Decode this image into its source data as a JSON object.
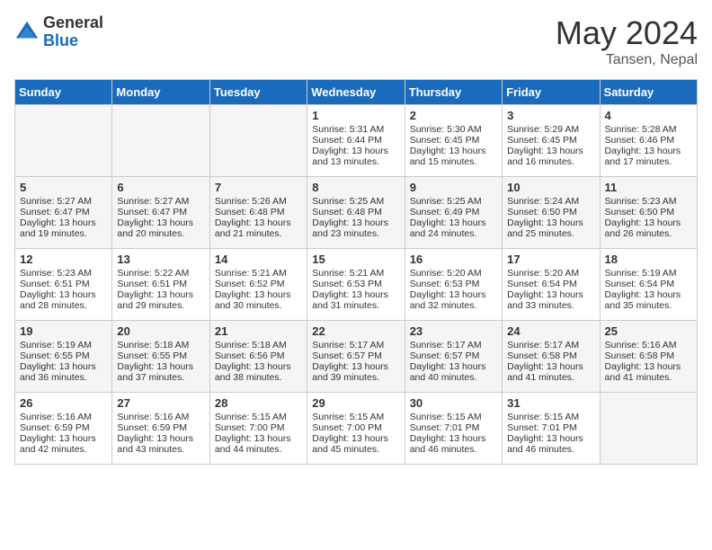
{
  "header": {
    "logo_general": "General",
    "logo_blue": "Blue",
    "month_year": "May 2024",
    "location": "Tansen, Nepal"
  },
  "days_of_week": [
    "Sunday",
    "Monday",
    "Tuesday",
    "Wednesday",
    "Thursday",
    "Friday",
    "Saturday"
  ],
  "weeks": [
    [
      {
        "day": "",
        "info": ""
      },
      {
        "day": "",
        "info": ""
      },
      {
        "day": "",
        "info": ""
      },
      {
        "day": "1",
        "info": "Sunrise: 5:31 AM\nSunset: 6:44 PM\nDaylight: 13 hours\nand 13 minutes."
      },
      {
        "day": "2",
        "info": "Sunrise: 5:30 AM\nSunset: 6:45 PM\nDaylight: 13 hours\nand 15 minutes."
      },
      {
        "day": "3",
        "info": "Sunrise: 5:29 AM\nSunset: 6:45 PM\nDaylight: 13 hours\nand 16 minutes."
      },
      {
        "day": "4",
        "info": "Sunrise: 5:28 AM\nSunset: 6:46 PM\nDaylight: 13 hours\nand 17 minutes."
      }
    ],
    [
      {
        "day": "5",
        "info": "Sunrise: 5:27 AM\nSunset: 6:47 PM\nDaylight: 13 hours\nand 19 minutes."
      },
      {
        "day": "6",
        "info": "Sunrise: 5:27 AM\nSunset: 6:47 PM\nDaylight: 13 hours\nand 20 minutes."
      },
      {
        "day": "7",
        "info": "Sunrise: 5:26 AM\nSunset: 6:48 PM\nDaylight: 13 hours\nand 21 minutes."
      },
      {
        "day": "8",
        "info": "Sunrise: 5:25 AM\nSunset: 6:48 PM\nDaylight: 13 hours\nand 23 minutes."
      },
      {
        "day": "9",
        "info": "Sunrise: 5:25 AM\nSunset: 6:49 PM\nDaylight: 13 hours\nand 24 minutes."
      },
      {
        "day": "10",
        "info": "Sunrise: 5:24 AM\nSunset: 6:50 PM\nDaylight: 13 hours\nand 25 minutes."
      },
      {
        "day": "11",
        "info": "Sunrise: 5:23 AM\nSunset: 6:50 PM\nDaylight: 13 hours\nand 26 minutes."
      }
    ],
    [
      {
        "day": "12",
        "info": "Sunrise: 5:23 AM\nSunset: 6:51 PM\nDaylight: 13 hours\nand 28 minutes."
      },
      {
        "day": "13",
        "info": "Sunrise: 5:22 AM\nSunset: 6:51 PM\nDaylight: 13 hours\nand 29 minutes."
      },
      {
        "day": "14",
        "info": "Sunrise: 5:21 AM\nSunset: 6:52 PM\nDaylight: 13 hours\nand 30 minutes."
      },
      {
        "day": "15",
        "info": "Sunrise: 5:21 AM\nSunset: 6:53 PM\nDaylight: 13 hours\nand 31 minutes."
      },
      {
        "day": "16",
        "info": "Sunrise: 5:20 AM\nSunset: 6:53 PM\nDaylight: 13 hours\nand 32 minutes."
      },
      {
        "day": "17",
        "info": "Sunrise: 5:20 AM\nSunset: 6:54 PM\nDaylight: 13 hours\nand 33 minutes."
      },
      {
        "day": "18",
        "info": "Sunrise: 5:19 AM\nSunset: 6:54 PM\nDaylight: 13 hours\nand 35 minutes."
      }
    ],
    [
      {
        "day": "19",
        "info": "Sunrise: 5:19 AM\nSunset: 6:55 PM\nDaylight: 13 hours\nand 36 minutes."
      },
      {
        "day": "20",
        "info": "Sunrise: 5:18 AM\nSunset: 6:55 PM\nDaylight: 13 hours\nand 37 minutes."
      },
      {
        "day": "21",
        "info": "Sunrise: 5:18 AM\nSunset: 6:56 PM\nDaylight: 13 hours\nand 38 minutes."
      },
      {
        "day": "22",
        "info": "Sunrise: 5:17 AM\nSunset: 6:57 PM\nDaylight: 13 hours\nand 39 minutes."
      },
      {
        "day": "23",
        "info": "Sunrise: 5:17 AM\nSunset: 6:57 PM\nDaylight: 13 hours\nand 40 minutes."
      },
      {
        "day": "24",
        "info": "Sunrise: 5:17 AM\nSunset: 6:58 PM\nDaylight: 13 hours\nand 41 minutes."
      },
      {
        "day": "25",
        "info": "Sunrise: 5:16 AM\nSunset: 6:58 PM\nDaylight: 13 hours\nand 41 minutes."
      }
    ],
    [
      {
        "day": "26",
        "info": "Sunrise: 5:16 AM\nSunset: 6:59 PM\nDaylight: 13 hours\nand 42 minutes."
      },
      {
        "day": "27",
        "info": "Sunrise: 5:16 AM\nSunset: 6:59 PM\nDaylight: 13 hours\nand 43 minutes."
      },
      {
        "day": "28",
        "info": "Sunrise: 5:15 AM\nSunset: 7:00 PM\nDaylight: 13 hours\nand 44 minutes."
      },
      {
        "day": "29",
        "info": "Sunrise: 5:15 AM\nSunset: 7:00 PM\nDaylight: 13 hours\nand 45 minutes."
      },
      {
        "day": "30",
        "info": "Sunrise: 5:15 AM\nSunset: 7:01 PM\nDaylight: 13 hours\nand 46 minutes."
      },
      {
        "day": "31",
        "info": "Sunrise: 5:15 AM\nSunset: 7:01 PM\nDaylight: 13 hours\nand 46 minutes."
      },
      {
        "day": "",
        "info": ""
      }
    ]
  ]
}
